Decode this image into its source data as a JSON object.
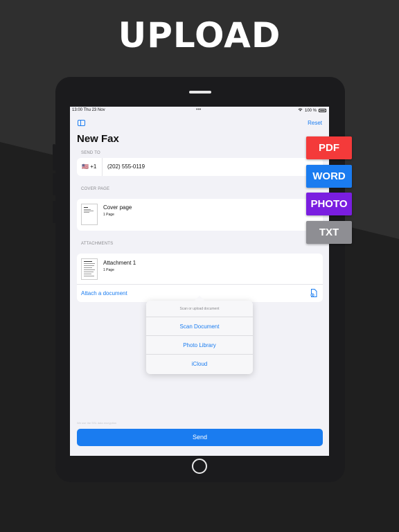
{
  "headline": "UPLOAD",
  "statusbar": {
    "time": "13:00  Thu 23 Nov",
    "dots": "•••",
    "battery_text": "100 %"
  },
  "nav": {
    "reset_label": "Reset"
  },
  "page": {
    "title": "New Fax"
  },
  "send_to": {
    "label": "SEND TO",
    "country_flag": "🇺🇸",
    "country_code": "+1",
    "phone_number": "(202) 555-0119"
  },
  "cover_page": {
    "label": "COVER PAGE",
    "name": "Cover page",
    "pages": "1 Page"
  },
  "attachments": {
    "label": "ATTACHMENTS",
    "items": [
      {
        "name": "Attachment 1",
        "pages": "1 Page"
      }
    ],
    "attach_link": "Attach a document"
  },
  "popover": {
    "header": "Scan or upload document",
    "options": [
      "Scan Document",
      "Photo Library",
      "iCloud"
    ]
  },
  "footer": {
    "note": "We use the SSL data encryption",
    "send_label": "Send"
  },
  "badges": [
    {
      "label": "PDF",
      "color": "#f43a3a"
    },
    {
      "label": "WORD",
      "color": "#1a7cf0"
    },
    {
      "label": "PHOTO",
      "color": "#7a1ee0"
    },
    {
      "label": "TXT",
      "color": "#8e8e93"
    }
  ],
  "colors": {
    "accent": "#1a7cf0",
    "background": "#2f2f2f"
  }
}
